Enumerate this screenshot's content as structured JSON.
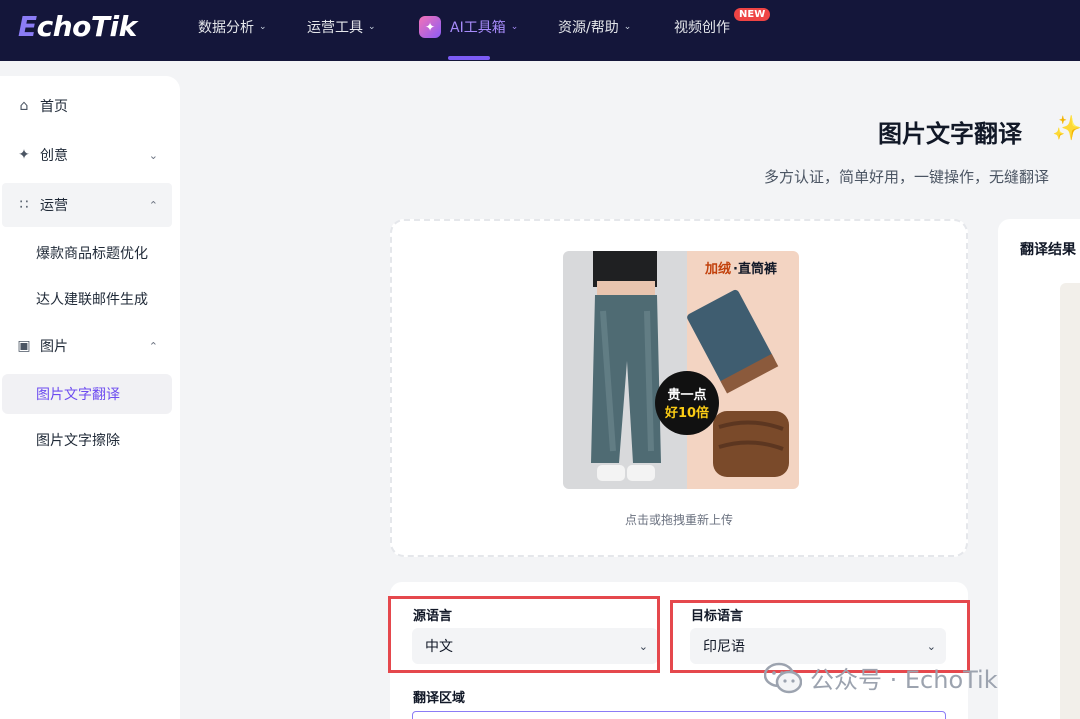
{
  "topnav": {
    "logo_e": "E",
    "logo_rest": "choTik",
    "items": [
      {
        "label": "数据分析"
      },
      {
        "label": "运营工具"
      },
      {
        "label": "AI工具箱"
      },
      {
        "label": "资源/帮助"
      },
      {
        "label": "视频创作"
      }
    ],
    "new_badge": "NEW"
  },
  "sidebar": {
    "items": [
      {
        "label": "首页",
        "icon": "home-icon"
      },
      {
        "label": "创意",
        "icon": "sparkle-icon"
      },
      {
        "label": "运营",
        "icon": "operation-icon"
      },
      {
        "label": "爆款商品标题优化"
      },
      {
        "label": "达人建联邮件生成"
      },
      {
        "label": "图片",
        "icon": "image-icon"
      },
      {
        "label": "图片文字翻译"
      },
      {
        "label": "图片文字擦除"
      }
    ]
  },
  "main": {
    "title": "图片文字翻译",
    "subtitle": "多方认证，简单好用，一键操作，无缝翻译",
    "upload_hint": "点击或拖拽重新上传",
    "product_text": {
      "tag1": "加绒",
      "tag2": "·直筒裤",
      "badge_line1": "贵一点",
      "badge_line2": "好10倍"
    },
    "result_title": "翻译结果",
    "source_lang_label": "源语言",
    "source_lang_value": "中文",
    "target_lang_label": "目标语言",
    "target_lang_value": "印尼语",
    "area_label": "翻译区域"
  },
  "watermark": {
    "text": "公众号 · EchoTik"
  },
  "colors": {
    "nav_bg": "#14163a",
    "accent": "#7c5cf5",
    "highlight_box": "#e5484d"
  }
}
